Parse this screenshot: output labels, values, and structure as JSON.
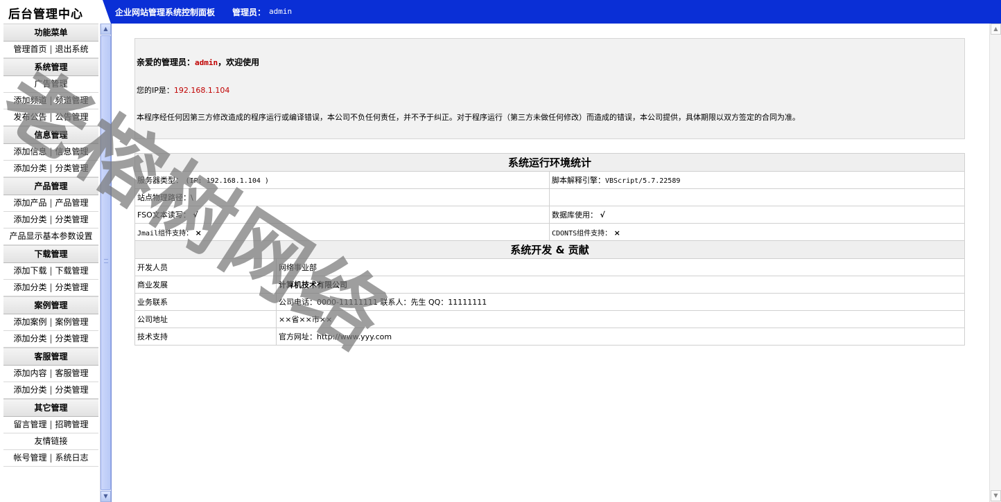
{
  "header": {
    "brand": "后台管理中心",
    "title": "企业网站管理系统控制面板",
    "admin_label": "管理员：",
    "admin_name": "admin"
  },
  "sidebar": {
    "groups": [
      {
        "title": "功能菜单",
        "rows": [
          [
            "管理首页",
            "退出系统"
          ]
        ]
      },
      {
        "title": "系统管理",
        "rows": [
          [
            "广告管理"
          ],
          [
            "添加频道",
            "频道管理"
          ],
          [
            "发布公告",
            "公告管理"
          ]
        ]
      },
      {
        "title": "信息管理",
        "rows": [
          [
            "添加信息",
            "信息管理"
          ],
          [
            "添加分类",
            "分类管理"
          ]
        ]
      },
      {
        "title": "产品管理",
        "rows": [
          [
            "添加产品",
            "产品管理"
          ],
          [
            "添加分类",
            "分类管理"
          ],
          [
            "产品显示基本参数设置"
          ]
        ]
      },
      {
        "title": "下载管理",
        "rows": [
          [
            "添加下载",
            "下载管理"
          ],
          [
            "添加分类",
            "分类管理"
          ]
        ]
      },
      {
        "title": "案例管理",
        "rows": [
          [
            "添加案例",
            "案例管理"
          ],
          [
            "添加分类",
            "分类管理"
          ]
        ]
      },
      {
        "title": "客服管理",
        "rows": [
          [
            "添加内容",
            "客服管理"
          ],
          [
            "添加分类",
            "分类管理"
          ]
        ]
      },
      {
        "title": "其它管理",
        "rows": [
          [
            "留言管理",
            "招聘管理"
          ],
          [
            "友情链接"
          ],
          [
            "帐号管理",
            "系统日志"
          ]
        ]
      }
    ],
    "scroll_up_icon": "arrow-up-icon",
    "scroll_down_icon": "arrow-down-icon"
  },
  "welcome": {
    "greet_prefix": "亲爱的管理员：",
    "greet_admin": "admin",
    "greet_suffix": "，欢迎使用",
    "ip_label": "您的IP是：",
    "ip_value": "192.168.1.104",
    "notice": "本程序经任何因第三方修改造成的程序运行或编译错误，本公司不负任何责任，并不予于纠正。对于程序运行（第三方未做任何修改）而造成的错误，本公司提供，具体期限以双方签定的合同为准。"
  },
  "env": {
    "heading": "系统运行环境统计",
    "server_type_label": "服务器类型：",
    "server_type_value": "(IP: 192.168.1.104 )",
    "script_engine_label": "脚本解释引擎：",
    "script_engine_value": "VBScript/5.7.22589",
    "path_label": "站点物理路径：",
    "path_value": "\\",
    "fso_label": "FSO文本读写：",
    "fso_value": "√",
    "db_label": "数据库使用：",
    "db_value": "√",
    "jmail_label": "Jmail组件支持：",
    "jmail_value": "×",
    "cdonts_label": "CDONTS组件支持：",
    "cdonts_value": "×"
  },
  "dev": {
    "heading": "系统开发 & 贡献",
    "rows": [
      {
        "label": "开发人员",
        "value": "网络事业部"
      },
      {
        "label": "商业发展",
        "value": "计算机技术有限公司"
      },
      {
        "label": "业务联系",
        "value": "公司电话：0000-11111111    联系人：先生    QQ：11111111"
      },
      {
        "label": "公司地址",
        "value": "××省××市××"
      },
      {
        "label": "技术支持",
        "value": "官方网址：http://www.yyy.com"
      }
    ]
  },
  "watermark": "老榕树网络",
  "colors": {
    "header_bg": "#0a2fd6",
    "accent_red": "#c00000"
  }
}
